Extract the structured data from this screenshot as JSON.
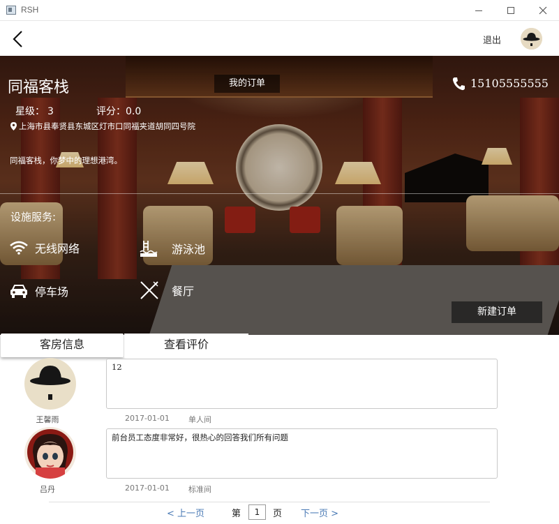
{
  "window": {
    "title": "RSH"
  },
  "header": {
    "logout_label": "退出"
  },
  "hotel": {
    "name": "同福客栈",
    "my_orders_label": "我的订单",
    "phone": "15105555555",
    "star_label": "星级：",
    "star_value": "3",
    "rating_label": "评分：",
    "rating_value": "0.0",
    "address": "上海市县奉贤县东城区灯市口同福夹道胡同四号院",
    "slogan": "同福客栈，你梦中的理想港湾。",
    "facilities_title": "设施服务:",
    "facilities": [
      {
        "label": "无线网络",
        "icon": "wifi-icon"
      },
      {
        "label": "游泳池",
        "icon": "pool-icon"
      },
      {
        "label": "停车场",
        "icon": "car-icon"
      },
      {
        "label": "餐厅",
        "icon": "restaurant-icon"
      }
    ],
    "new_order_label": "新建订单"
  },
  "tabs": [
    {
      "label": "客房信息",
      "active": true
    },
    {
      "label": "查看评价",
      "active": false
    }
  ],
  "reviews": [
    {
      "user": "王馨雨",
      "text": "12",
      "date": "2017-01-01",
      "room": "单人间"
    },
    {
      "user": "吕丹",
      "text": "前台员工态度非常好，很热心的回答我们所有问题",
      "date": "2017-01-01",
      "room": "标准间"
    }
  ],
  "pager": {
    "prev_label": "< 上一页",
    "page_prefix": "第",
    "page_value": "1",
    "page_suffix": "页",
    "next_label": "下一页 >"
  }
}
